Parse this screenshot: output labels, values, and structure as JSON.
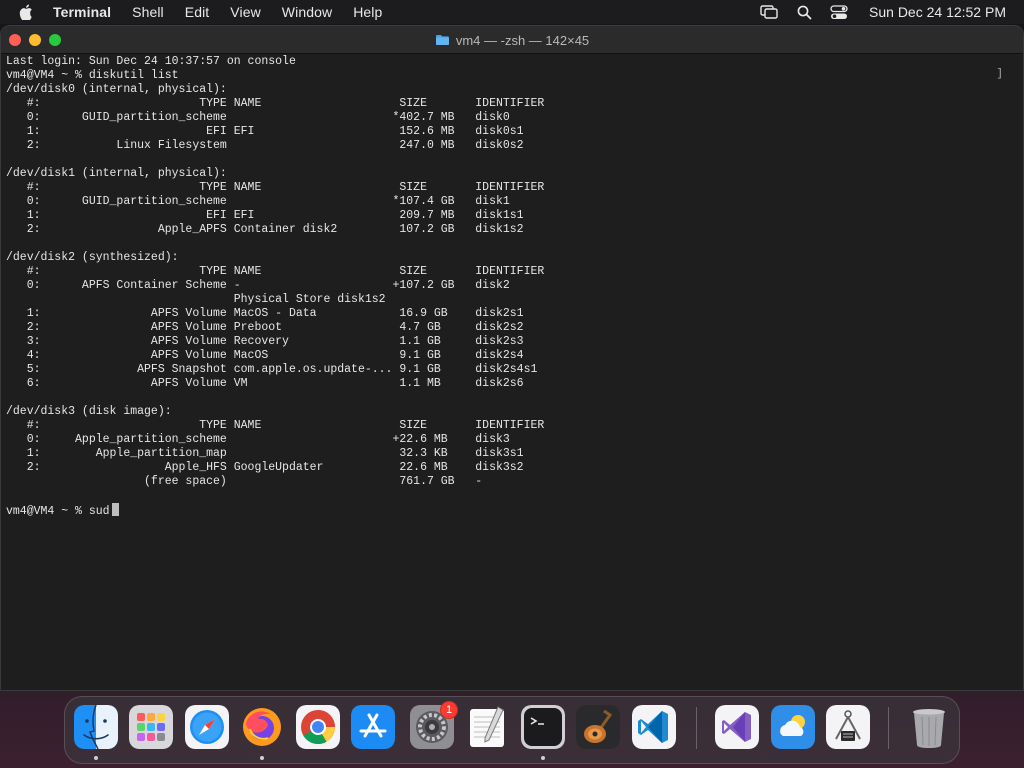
{
  "menubar": {
    "app_name": "Terminal",
    "items": [
      "Shell",
      "Edit",
      "View",
      "Window",
      "Help"
    ],
    "clock": "Sun Dec 24  12:52 PM",
    "icons": [
      "apple-icon",
      "screen-mirroring-icon",
      "spotlight-search-icon",
      "control-center-icon"
    ]
  },
  "window": {
    "title": "vm4 — -zsh — 142×45",
    "scroll_bracket": "]"
  },
  "terminal": {
    "lines": [
      "Last login: Sun Dec 24 10:37:57 on console",
      "vm4@VM4 ~ % diskutil list",
      "/dev/disk0 (internal, physical):",
      "   #:                       TYPE NAME                    SIZE       IDENTIFIER",
      "   0:      GUID_partition_scheme                        *402.7 MB   disk0",
      "   1:                        EFI EFI                     152.6 MB   disk0s1",
      "   2:           Linux Filesystem                         247.0 MB   disk0s2",
      "",
      "/dev/disk1 (internal, physical):",
      "   #:                       TYPE NAME                    SIZE       IDENTIFIER",
      "   0:      GUID_partition_scheme                        *107.4 GB   disk1",
      "   1:                        EFI EFI                     209.7 MB   disk1s1",
      "   2:                 Apple_APFS Container disk2         107.2 GB   disk1s2",
      "",
      "/dev/disk2 (synthesized):",
      "   #:                       TYPE NAME                    SIZE       IDENTIFIER",
      "   0:      APFS Container Scheme -                      +107.2 GB   disk2",
      "                                 Physical Store disk1s2",
      "   1:                APFS Volume MacOS - Data            16.9 GB    disk2s1",
      "   2:                APFS Volume Preboot                 4.7 GB     disk2s2",
      "   3:                APFS Volume Recovery                1.1 GB     disk2s3",
      "   4:                APFS Volume MacOS                   9.1 GB     disk2s4",
      "   5:              APFS Snapshot com.apple.os.update-... 9.1 GB     disk2s4s1",
      "   6:                APFS Volume VM                      1.1 MB     disk2s6",
      "",
      "/dev/disk3 (disk image):",
      "   #:                       TYPE NAME                    SIZE       IDENTIFIER",
      "   0:     Apple_partition_scheme                        +22.6 MB    disk3",
      "   1:        Apple_partition_map                         32.3 KB    disk3s1",
      "   2:                  Apple_HFS GoogleUpdater           22.6 MB    disk3s2",
      "                    (free space)                         761.7 GB   -",
      ""
    ],
    "prompt_line": "vm4@VM4 ~ % sud"
  },
  "dock": {
    "apps": [
      {
        "name": "Finder",
        "icon": "finder-icon",
        "running": true
      },
      {
        "name": "Launchpad",
        "icon": "launchpad-icon",
        "running": false
      },
      {
        "name": "Safari",
        "icon": "safari-icon",
        "running": false
      },
      {
        "name": "Firefox",
        "icon": "firefox-icon",
        "running": true
      },
      {
        "name": "Google Chrome",
        "icon": "chrome-icon",
        "running": false
      },
      {
        "name": "App Store",
        "icon": "app-store-icon",
        "running": false
      },
      {
        "name": "System Preferences",
        "icon": "system-preferences-icon",
        "running": false,
        "badge": "1"
      },
      {
        "name": "TextEdit",
        "icon": "textedit-icon",
        "running": false
      },
      {
        "name": "Terminal",
        "icon": "terminal-icon",
        "running": true
      },
      {
        "name": "GarageBand",
        "icon": "garageband-icon",
        "running": false
      },
      {
        "name": "Visual Studio Code",
        "icon": "vscode-icon",
        "running": false
      },
      {
        "name": "Visual Studio",
        "icon": "visual-studio-icon",
        "running": false
      },
      {
        "name": "Weather",
        "icon": "weather-icon",
        "running": false
      },
      {
        "name": "System Information",
        "icon": "system-information-icon",
        "running": false
      },
      {
        "name": "Trash",
        "icon": "trash-icon",
        "running": false
      }
    ]
  },
  "colors": {
    "accent_badge": "#ff3b30",
    "terminal_bg": "#1e1e1e",
    "terminal_text": "#e6e6e6"
  }
}
